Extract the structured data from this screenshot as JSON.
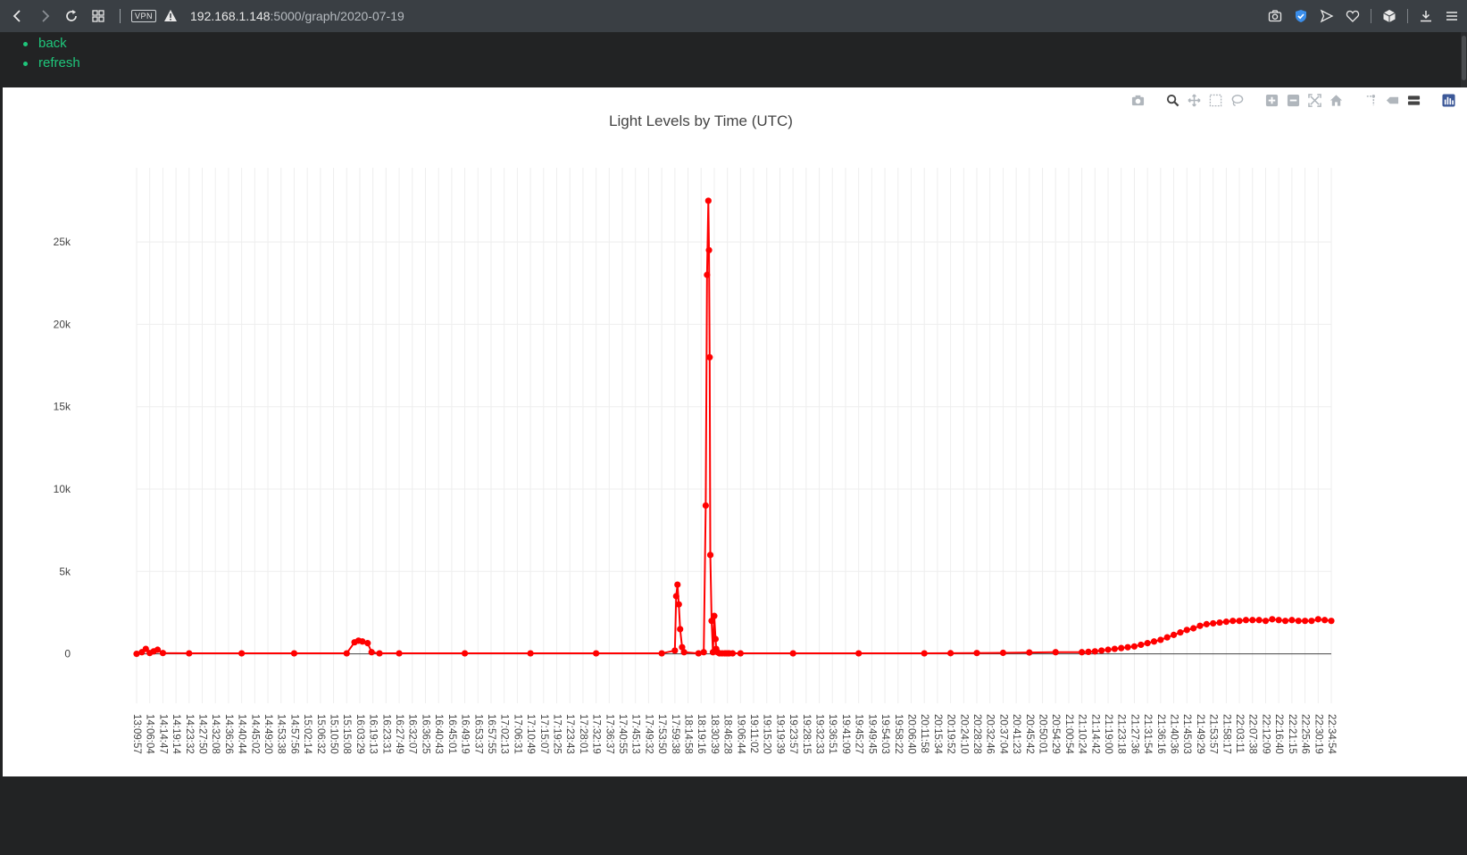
{
  "browser": {
    "url_host": "192.168.1.148",
    "url_rest": ":5000/graph/2020-07-19",
    "vpn_label": "VPN",
    "icons": [
      "back-icon",
      "forward-icon",
      "reload-icon",
      "tabs-grid-icon",
      "vpn-badge",
      "warning-icon",
      "camera-icon",
      "shield-icon",
      "send-icon",
      "heart-icon",
      "box-icon",
      "download-icon",
      "menu-icon"
    ]
  },
  "nav": {
    "links": [
      {
        "label": "back"
      },
      {
        "label": "refresh"
      }
    ]
  },
  "modebar": {
    "icons": [
      "camera-icon",
      "zoom-icon",
      "pan-icon",
      "box-select-icon",
      "lasso-icon",
      "zoom-in-icon",
      "zoom-out-icon",
      "autoscale-icon",
      "reset-axes-icon",
      "spike-lines-icon",
      "hover-closest-icon",
      "hover-compare-icon",
      "plotly-logo-icon"
    ]
  },
  "chart_data": {
    "type": "scatter",
    "mode": "lines+markers",
    "title": "Light Levels by Time (UTC)",
    "xlabel": "",
    "ylabel": "",
    "ylim": [
      -3000,
      29500
    ],
    "yticks": [
      0,
      5000,
      10000,
      15000,
      20000,
      25000
    ],
    "ytick_labels": [
      "0",
      "5k",
      "10k",
      "15k",
      "20k",
      "25k"
    ],
    "grid": true,
    "color": "#ff0000",
    "xtick_labels": [
      "13:09:57",
      "14:06:04",
      "14:14:47",
      "14:19:14",
      "14:23:32",
      "14:27:50",
      "14:32:08",
      "14:36:26",
      "14:40:44",
      "14:45:02",
      "14:49:20",
      "14:53:38",
      "14:57:56",
      "15:02:14",
      "15:06:32",
      "15:10:50",
      "15:15:08",
      "16:03:29",
      "16:19:13",
      "16:23:31",
      "16:27:49",
      "16:32:07",
      "16:36:25",
      "16:40:43",
      "16:45:01",
      "16:49:19",
      "16:53:37",
      "16:57:55",
      "17:02:13",
      "17:06:31",
      "17:10:49",
      "17:15:07",
      "17:19:25",
      "17:23:43",
      "17:28:01",
      "17:32:19",
      "17:36:37",
      "17:40:55",
      "17:45:13",
      "17:49:32",
      "17:53:50",
      "17:59:38",
      "18:14:58",
      "18:19:16",
      "18:30:39",
      "18:46:28",
      "19:06:44",
      "19:11:02",
      "19:15:20",
      "19:19:39",
      "19:23:57",
      "19:28:15",
      "19:32:33",
      "19:36:51",
      "19:41:09",
      "19:45:27",
      "19:49:45",
      "19:54:03",
      "19:58:22",
      "20:06:40",
      "20:11:58",
      "20:15:34",
      "20:19:52",
      "20:24:10",
      "20:28:28",
      "20:32:46",
      "20:37:04",
      "20:41:23",
      "20:45:42",
      "20:50:01",
      "20:54:29",
      "21:00:54",
      "21:10:24",
      "21:14:42",
      "21:19:00",
      "21:23:18",
      "21:27:36",
      "21:31:54",
      "21:36:16",
      "21:40:36",
      "21:45:03",
      "21:49:29",
      "21:53:57",
      "21:58:17",
      "22:03:11",
      "22:07:38",
      "22:12:09",
      "22:16:40",
      "22:21:15",
      "22:25:46",
      "22:30:19",
      "22:34:54"
    ],
    "series": [
      {
        "x_index": [
          0,
          0.4,
          0.7,
          1.0,
          1.3,
          1.6,
          2.0,
          4,
          8,
          12,
          16,
          16.6,
          16.9,
          17.2,
          17.6,
          17.9,
          18.5,
          20,
          25,
          30,
          35,
          40,
          41.0,
          41.1,
          41.2,
          41.3,
          41.4,
          41.55,
          41.7,
          42.8,
          43.2,
          43.35,
          43.45,
          43.55,
          43.6,
          43.65,
          43.7,
          43.8,
          43.9,
          44.0,
          44.1,
          44.15,
          44.25,
          44.4,
          44.6,
          44.8,
          44.9,
          45.05,
          45.15,
          45.4,
          46,
          50,
          55,
          60,
          62,
          64,
          66,
          68,
          70,
          72,
          72.5,
          73,
          73.5,
          74,
          74.5,
          75,
          75.5,
          76,
          76.5,
          77,
          77.5,
          78,
          78.5,
          79,
          79.5,
          80,
          80.5,
          81,
          81.5,
          82,
          82.5,
          83,
          83.5,
          84,
          84.5,
          85,
          85.5,
          86,
          86.5,
          87,
          87.5,
          88,
          88.5,
          89,
          89.5,
          90,
          90.5,
          91
        ],
        "y": [
          0,
          100,
          300,
          50,
          150,
          250,
          50,
          30,
          30,
          30,
          30,
          700,
          800,
          750,
          650,
          100,
          30,
          30,
          30,
          30,
          30,
          30,
          200,
          3500,
          4200,
          3000,
          1500,
          400,
          100,
          30,
          100,
          9000,
          23000,
          27500,
          24500,
          18000,
          6000,
          2000,
          100,
          2300,
          900,
          300,
          100,
          30,
          30,
          30,
          30,
          30,
          30,
          30,
          30,
          30,
          30,
          30,
          40,
          50,
          60,
          80,
          100,
          100,
          120,
          150,
          200,
          250,
          300,
          350,
          400,
          450,
          550,
          650,
          750,
          850,
          1000,
          1150,
          1300,
          1450,
          1550,
          1700,
          1800,
          1850,
          1900,
          1950,
          2000,
          2000,
          2050,
          2050,
          2050,
          2000,
          2100,
          2050,
          2000,
          2050,
          2000,
          2000,
          2000,
          2100,
          2050,
          2000,
          1950,
          2100,
          2200
        ]
      }
    ]
  }
}
